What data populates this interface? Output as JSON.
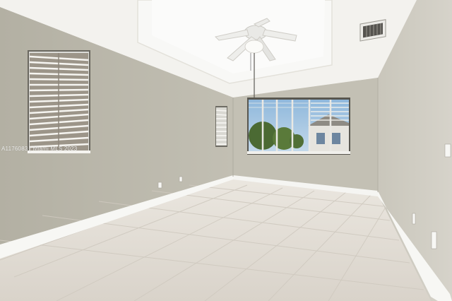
{
  "image": {
    "watermark": "A1176083 | Miami MLS 2023"
  },
  "colors": {
    "wall_left": "#b9b6a9",
    "wall_back": "#c2bfb3",
    "wall_right": "#cdcabf",
    "ceiling": "#f1f0ec",
    "floor": "#e2ddd5",
    "baseboard": "#f7f7f4",
    "window_glass": "#9fc3df",
    "blinds": "#f3f2ee"
  }
}
